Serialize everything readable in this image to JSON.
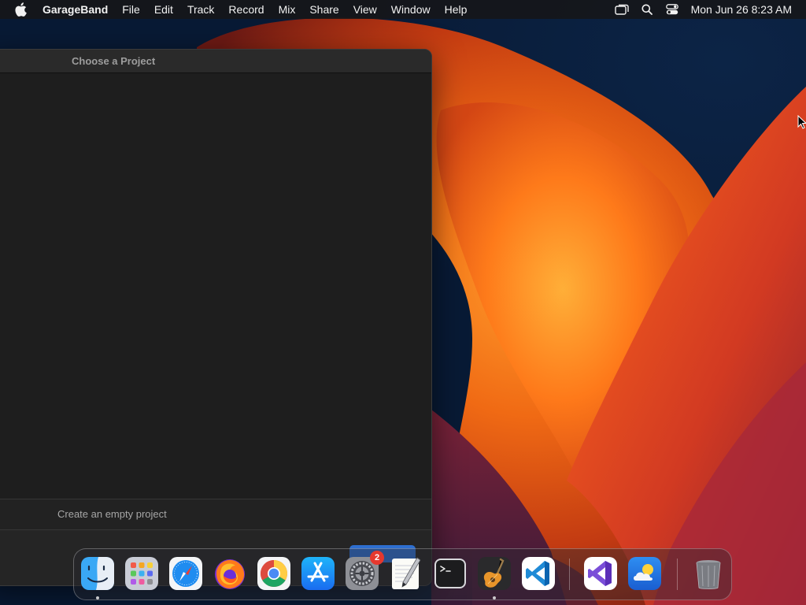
{
  "colors": {
    "menubar_bg": "#161618",
    "window_bg": "#1e1e1e",
    "accent_blue": "#2e6fd0",
    "badge_red": "#e5382e"
  },
  "menubar": {
    "apple_icon": "apple-logo-icon",
    "app_name": "GarageBand",
    "menus": [
      "File",
      "Edit",
      "Track",
      "Record",
      "Mix",
      "Share",
      "View",
      "Window",
      "Help"
    ],
    "status_icons": [
      "screen-mirroring-icon",
      "spotlight-search-icon",
      "control-center-icon"
    ],
    "clock": "Mon Jun 26  8:23 AM"
  },
  "window": {
    "title": "Choose a Project",
    "description": "Create an empty project"
  },
  "dock": {
    "apps": [
      {
        "name": "Finder",
        "icon": "finder-icon",
        "running": true
      },
      {
        "name": "Launchpad",
        "icon": "launchpad-icon",
        "running": false
      },
      {
        "name": "Safari",
        "icon": "safari-icon",
        "running": false
      },
      {
        "name": "Firefox",
        "icon": "firefox-icon",
        "running": false
      },
      {
        "name": "Google Chrome",
        "icon": "chrome-icon",
        "running": false
      },
      {
        "name": "App Store",
        "icon": "app-store-icon",
        "running": false
      },
      {
        "name": "System Settings",
        "icon": "system-settings-icon",
        "running": false,
        "badge": "2"
      },
      {
        "name": "TextEdit",
        "icon": "textedit-icon",
        "running": false
      },
      {
        "name": "Terminal",
        "icon": "terminal-icon",
        "running": false
      },
      {
        "name": "GarageBand",
        "icon": "garageband-icon",
        "running": true
      },
      {
        "name": "Visual Studio Code",
        "icon": "vscode-icon",
        "running": false
      },
      {
        "name": "Visual Studio",
        "icon": "visual-studio-icon",
        "running": false
      },
      {
        "name": "Weather",
        "icon": "weather-icon",
        "running": false
      },
      {
        "name": "Trash",
        "icon": "trash-icon",
        "running": false
      }
    ]
  }
}
